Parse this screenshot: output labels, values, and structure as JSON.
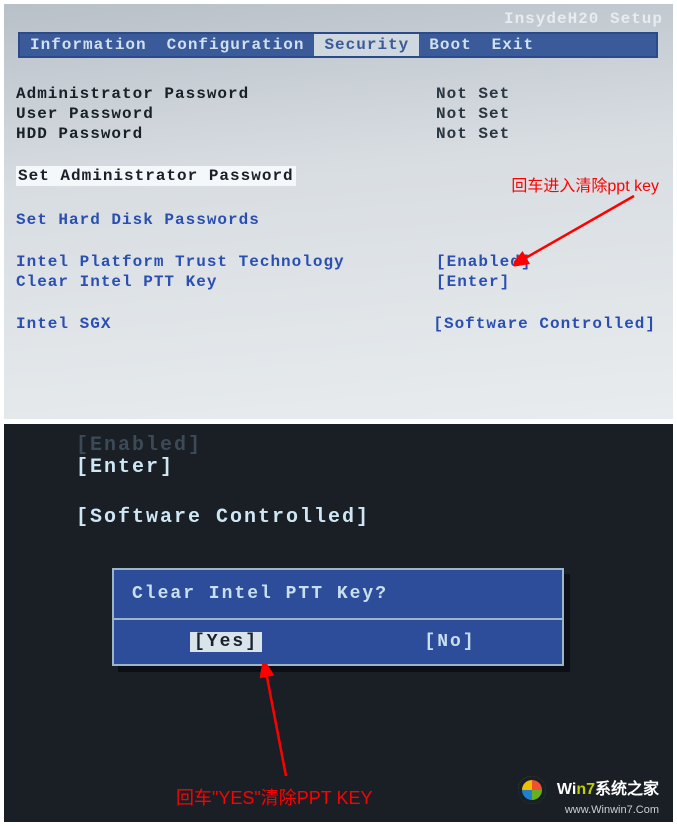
{
  "top": {
    "setup_title": "InsydeH20 Setup",
    "tabs": {
      "information": "Information",
      "configuration": "Configuration",
      "security": "Security",
      "boot": "Boot",
      "exit": "Exit"
    },
    "admin_pw": {
      "label": "Administrator Password",
      "value": "Not Set"
    },
    "user_pw": {
      "label": "User Password",
      "value": "Not Set"
    },
    "hdd_pw": {
      "label": "HDD Password",
      "value": "Not Set"
    },
    "set_admin_pw": "Set Administrator Password",
    "set_hdd_pw": "Set Hard Disk Passwords",
    "intel_ptt": {
      "label": "Intel Platform Trust Technology",
      "value": "[Enabled]"
    },
    "clear_ptt": {
      "label": "Clear Intel PTT Key",
      "value": "[Enter]"
    },
    "intel_sgx": {
      "label": "Intel SGX",
      "value": "[Software Controlled]"
    },
    "annotation": "回车进入清除ppt key"
  },
  "bottom": {
    "line_dim": "[Enabled]",
    "line_enter": "[Enter]",
    "line_sw": "[Software Controlled]",
    "dialog": {
      "title": "Clear Intel PTT Key?",
      "yes": "[Yes]",
      "no": "[No]"
    },
    "annotation": "回车\"YES\"清除PPT KEY",
    "brand": {
      "line1_a": "Wi",
      "line1_b": "n7",
      "line1_c": "系统之家",
      "line2": "www.Winwin7.Com"
    }
  }
}
